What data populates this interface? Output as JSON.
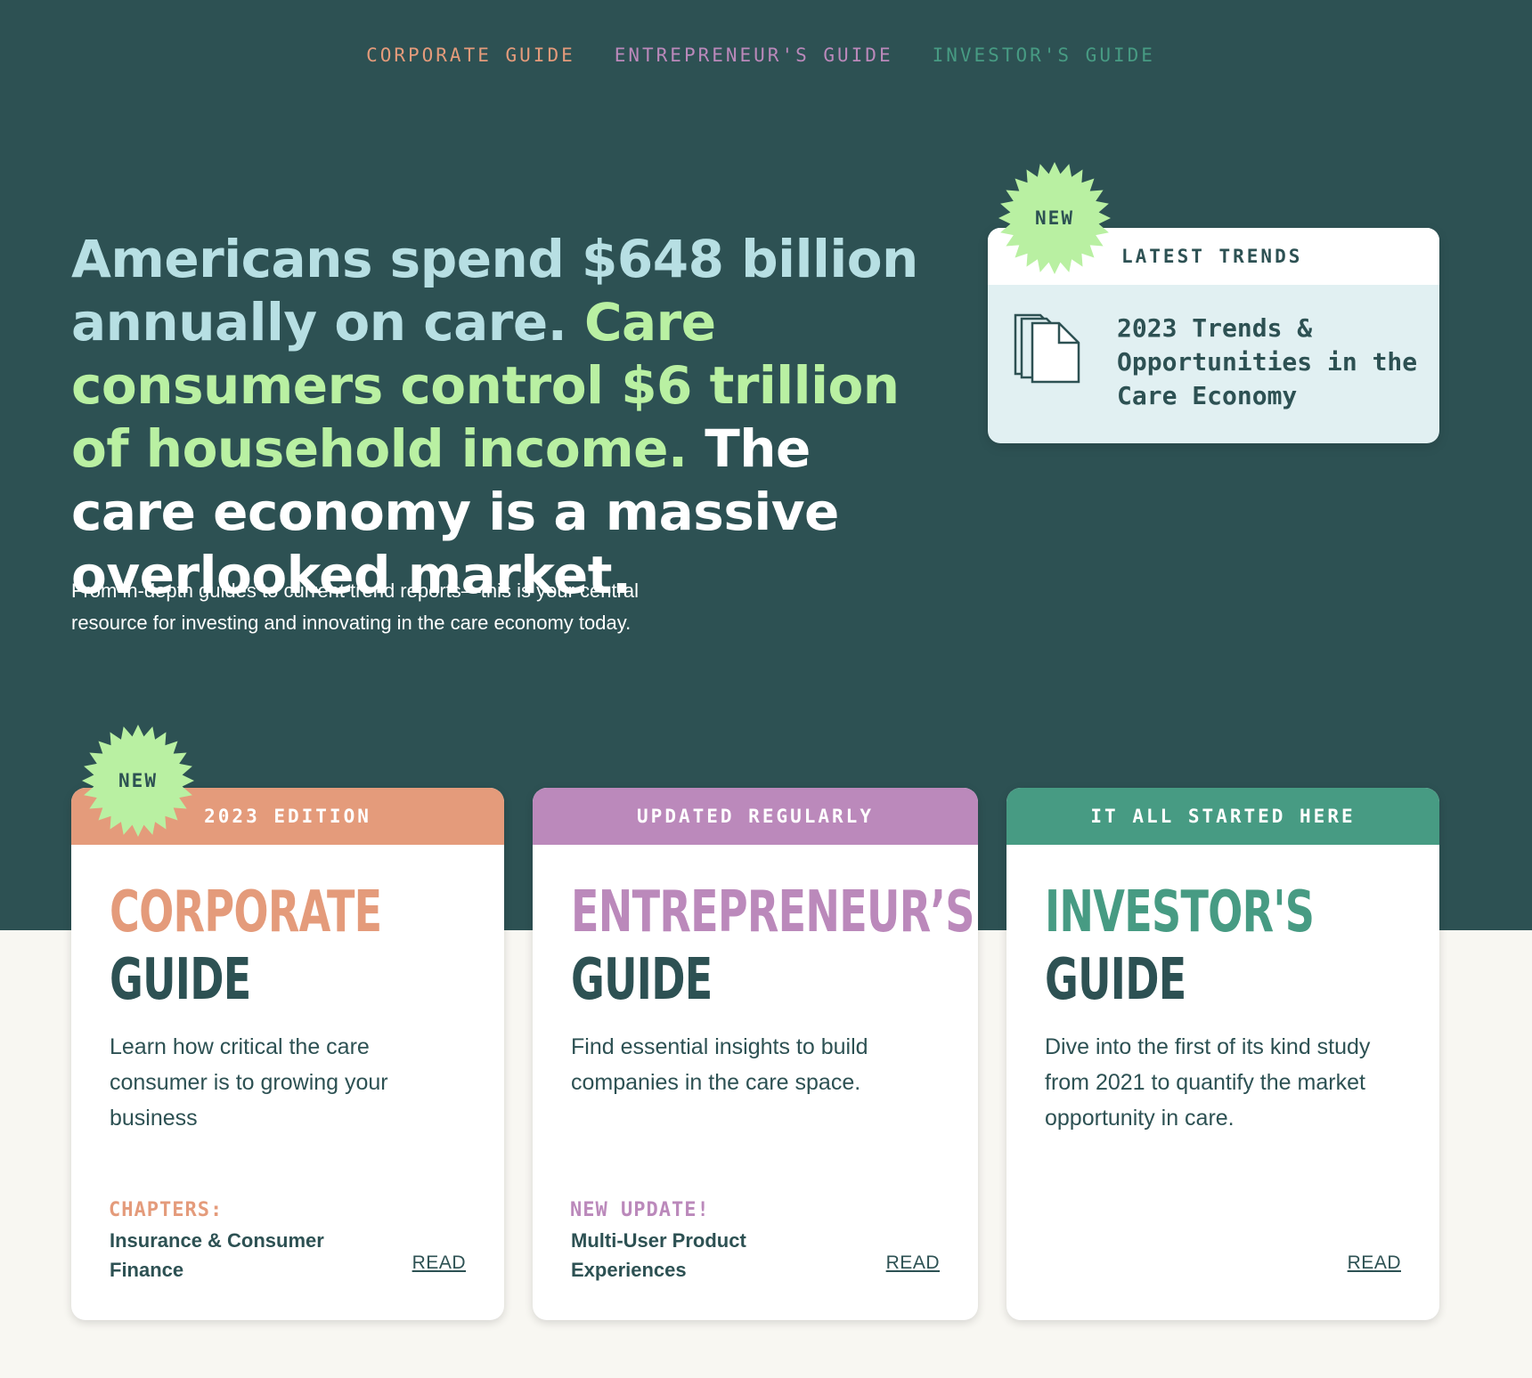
{
  "nav": {
    "items": [
      {
        "label": "CORPORATE GUIDE",
        "color": "#e49b7b"
      },
      {
        "label": "ENTREPRENEUR'S GUIDE",
        "color": "#bb89bb"
      },
      {
        "label": "INVESTOR'S GUIDE",
        "color": "#479b83"
      }
    ]
  },
  "hero": {
    "headline_part1": "Americans spend $648 billion annually on care. ",
    "headline_part2": "Care consumers control $6 trillion of household income.",
    "headline_part3": " The care economy is a massive overlooked market.",
    "subtext": "From in-depth guides to current trend reports—this is your central resource for investing and innovating in the care economy today."
  },
  "trend_card": {
    "badge": "NEW",
    "header": "LATEST TRENDS",
    "icon": "document-stack-icon",
    "title": "2023 Trends & Opportunities in the Care Economy"
  },
  "cards": [
    {
      "badge": "NEW",
      "band": "2023 EDITION",
      "title_top": "CORPORATE",
      "title_bottom": "GUIDE",
      "description": "Learn how critical the care consumer is to growing your business",
      "label": "CHAPTERS:",
      "meta": "Insurance & Consumer Finance",
      "read": "READ",
      "color": "#e49b7b"
    },
    {
      "band": "UPDATED REGULARLY",
      "title_top": "ENTREPRENEUR’S",
      "title_bottom": "GUIDE",
      "description": "Find essential insights to build companies in the care space.",
      "label": "NEW UPDATE!",
      "meta": "Multi-User Product Experiences",
      "read": "READ",
      "color": "#bb89bb"
    },
    {
      "band": "IT ALL STARTED HERE",
      "title_top": "INVESTOR'S",
      "title_bottom": "GUIDE",
      "description": "Dive into the first of its kind study from 2021 to quantify the market opportunity in care.",
      "read": "READ",
      "color": "#479b83"
    }
  ],
  "colors": {
    "hero_bg": "#2d5153",
    "page_bg": "#f8f7f2",
    "burst": "#b9f0a2",
    "headline_blue": "#b7dfe3",
    "headline_green": "#b9f0a2",
    "text_dark": "#2d5153"
  }
}
